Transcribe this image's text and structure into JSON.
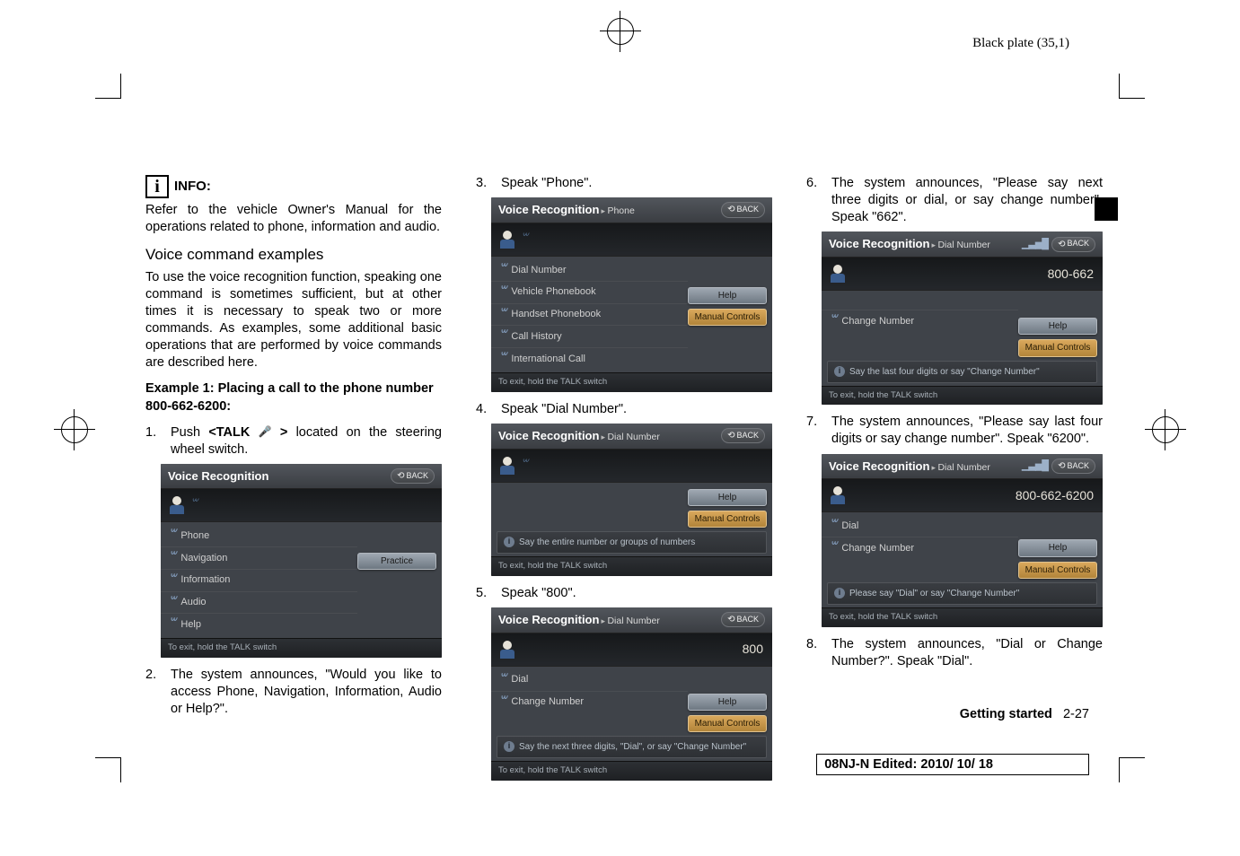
{
  "header": {
    "plate": "Black plate (35,1)"
  },
  "col1": {
    "info_label": "INFO:",
    "info_text": "Refer to the vehicle Owner's Manual for the operations related to phone, information and audio.",
    "sub_heading": "Voice command examples",
    "sub_text": "To use the voice recognition function, speaking one command is sometimes sufficient, but at other times it is necessary to speak two or more commands. As examples, some additional basic operations that are performed by voice commands are described here.",
    "ex_heading": "Example 1: Placing a call to the phone number 800-662-6200:",
    "step1_pre": "Push ",
    "step1_talk_open": "<TALK ",
    "step1_talk_close": " >",
    "step1_post": " located on the steering wheel switch.",
    "step2": "The system announces, \"Would you like to access Phone, Navigation, Information, Audio or Help?\"."
  },
  "col2": {
    "step3": "Speak \"Phone\".",
    "step4": "Speak \"Dial Number\".",
    "step5": "Speak \"800\"."
  },
  "col3": {
    "step6": "The system announces, \"Please say next three digits or dial, or say change number\". Speak \"662\".",
    "step7": "The system announces, \"Please say last four digits or say change number\". Speak \"6200\".",
    "step8": "The system announces, \"Dial or Change Number?\". Speak \"Dial\"."
  },
  "box_common": {
    "vr_title": "Voice Recognition",
    "back": "BACK",
    "help": "Help",
    "manual": "Manual Controls",
    "practice": "Practice",
    "footer": "To exit, hold the TALK switch"
  },
  "box1": {
    "items": [
      "Phone",
      "Navigation",
      "Information",
      "Audio",
      "Help"
    ]
  },
  "box2": {
    "crumb": "Phone",
    "items": [
      "Dial Number",
      "Vehicle Phonebook",
      "Handset Phonebook",
      "Call History",
      "International Call"
    ]
  },
  "box3": {
    "crumb": "Dial Number",
    "hint": "Say the entire number or groups of numbers"
  },
  "box4": {
    "crumb": "Dial Number",
    "display": "800",
    "items": [
      "Dial",
      "Change Number"
    ],
    "hint": "Say the next three digits, \"Dial\", or say \"Change Number\""
  },
  "box5": {
    "crumb": "Dial Number",
    "display": "800-662",
    "items": [
      "Change Number"
    ],
    "hint": "Say the last four digits or say \"Change Number\""
  },
  "box6": {
    "crumb": "Dial Number",
    "display": "800-662-6200",
    "items": [
      "Dial",
      "Change Number"
    ],
    "hint": "Please say \"Dial\" or say \"Change Number\""
  },
  "footer": {
    "section": "Getting started",
    "page": "2-27",
    "edit": "08NJ-N Edited:  2010/ 10/ 18"
  }
}
